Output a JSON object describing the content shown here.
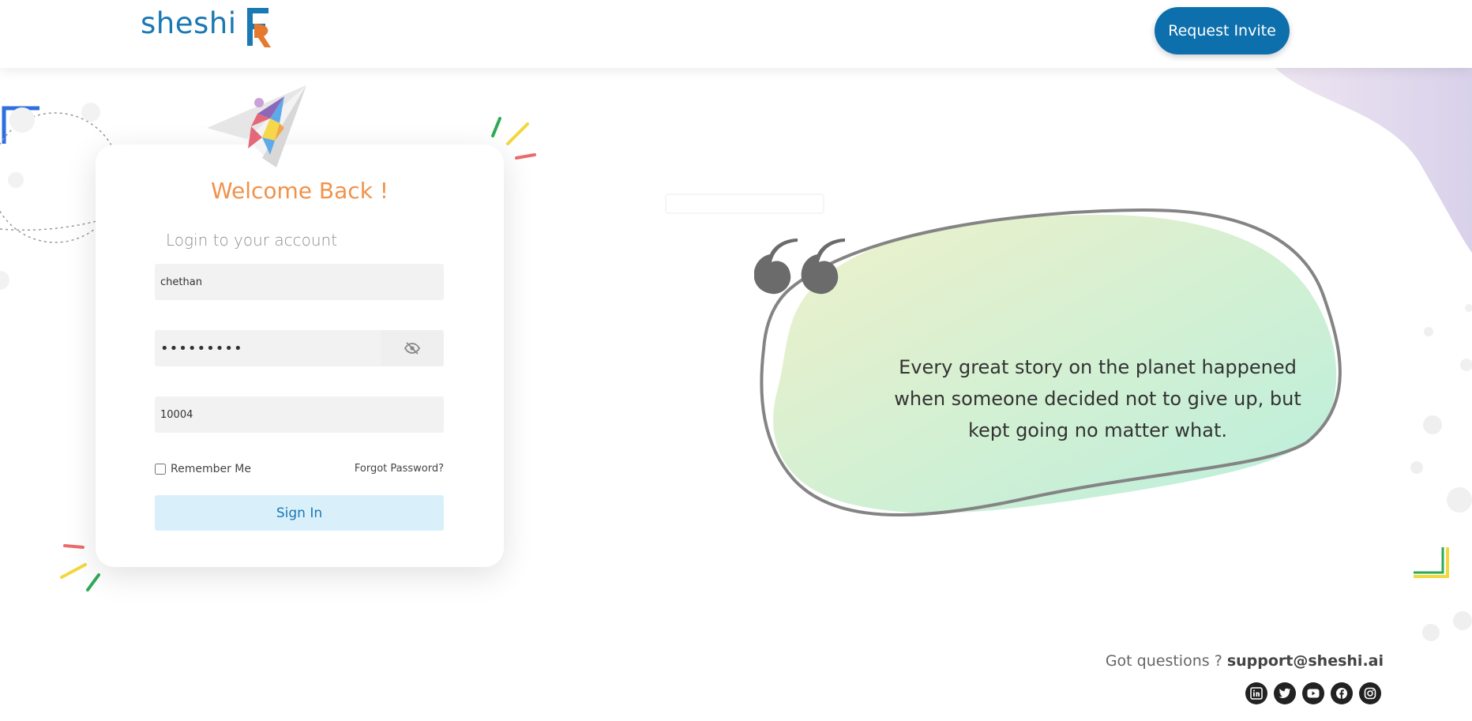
{
  "header": {
    "logo_text": "sheshi",
    "request_invite_label": "Request Invite"
  },
  "login": {
    "title": "Welcome Back !",
    "subtitle": "Login to your account",
    "username_value": "chethan",
    "password_value": "•••••••••",
    "code_value": "10004",
    "remember_label": "Remember Me",
    "forgot_label": "Forgot Password?",
    "signin_label": "Sign In"
  },
  "quote": {
    "text": "Every great story on the planet happened when someone decided not to give up, but kept going no matter what."
  },
  "footer": {
    "question": "Got questions ?",
    "email": "support@sheshi.ai",
    "socials": [
      "linkedin-icon",
      "twitter-icon",
      "youtube-icon",
      "facebook-icon",
      "instagram-icon"
    ]
  },
  "colors": {
    "brand_blue": "#0d6fac",
    "accent_orange": "#f0924a",
    "signin_bg": "#d9f0fa"
  }
}
